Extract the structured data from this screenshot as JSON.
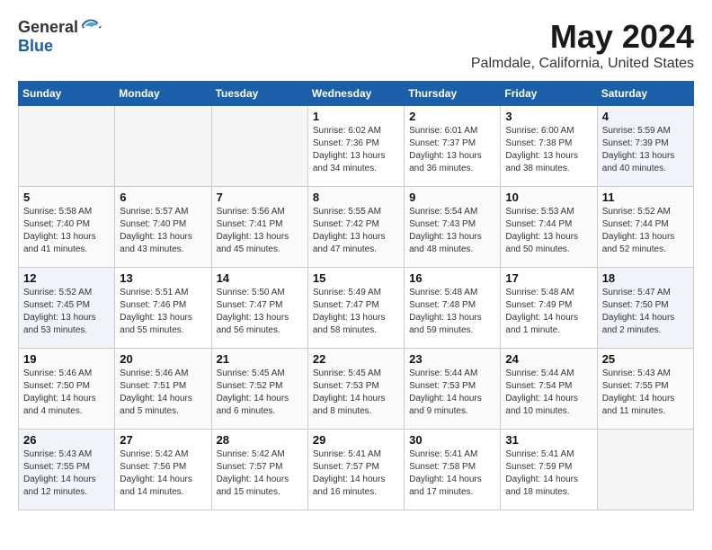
{
  "header": {
    "logo_general": "General",
    "logo_blue": "Blue",
    "month": "May 2024",
    "location": "Palmdale, California, United States"
  },
  "weekdays": [
    "Sunday",
    "Monday",
    "Tuesday",
    "Wednesday",
    "Thursday",
    "Friday",
    "Saturday"
  ],
  "weeks": [
    [
      {
        "day": "",
        "info": ""
      },
      {
        "day": "",
        "info": ""
      },
      {
        "day": "",
        "info": ""
      },
      {
        "day": "1",
        "info": "Sunrise: 6:02 AM\nSunset: 7:36 PM\nDaylight: 13 hours\nand 34 minutes."
      },
      {
        "day": "2",
        "info": "Sunrise: 6:01 AM\nSunset: 7:37 PM\nDaylight: 13 hours\nand 36 minutes."
      },
      {
        "day": "3",
        "info": "Sunrise: 6:00 AM\nSunset: 7:38 PM\nDaylight: 13 hours\nand 38 minutes."
      },
      {
        "day": "4",
        "info": "Sunrise: 5:59 AM\nSunset: 7:39 PM\nDaylight: 13 hours\nand 40 minutes."
      }
    ],
    [
      {
        "day": "5",
        "info": "Sunrise: 5:58 AM\nSunset: 7:40 PM\nDaylight: 13 hours\nand 41 minutes."
      },
      {
        "day": "6",
        "info": "Sunrise: 5:57 AM\nSunset: 7:40 PM\nDaylight: 13 hours\nand 43 minutes."
      },
      {
        "day": "7",
        "info": "Sunrise: 5:56 AM\nSunset: 7:41 PM\nDaylight: 13 hours\nand 45 minutes."
      },
      {
        "day": "8",
        "info": "Sunrise: 5:55 AM\nSunset: 7:42 PM\nDaylight: 13 hours\nand 47 minutes."
      },
      {
        "day": "9",
        "info": "Sunrise: 5:54 AM\nSunset: 7:43 PM\nDaylight: 13 hours\nand 48 minutes."
      },
      {
        "day": "10",
        "info": "Sunrise: 5:53 AM\nSunset: 7:44 PM\nDaylight: 13 hours\nand 50 minutes."
      },
      {
        "day": "11",
        "info": "Sunrise: 5:52 AM\nSunset: 7:44 PM\nDaylight: 13 hours\nand 52 minutes."
      }
    ],
    [
      {
        "day": "12",
        "info": "Sunrise: 5:52 AM\nSunset: 7:45 PM\nDaylight: 13 hours\nand 53 minutes."
      },
      {
        "day": "13",
        "info": "Sunrise: 5:51 AM\nSunset: 7:46 PM\nDaylight: 13 hours\nand 55 minutes."
      },
      {
        "day": "14",
        "info": "Sunrise: 5:50 AM\nSunset: 7:47 PM\nDaylight: 13 hours\nand 56 minutes."
      },
      {
        "day": "15",
        "info": "Sunrise: 5:49 AM\nSunset: 7:47 PM\nDaylight: 13 hours\nand 58 minutes."
      },
      {
        "day": "16",
        "info": "Sunrise: 5:48 AM\nSunset: 7:48 PM\nDaylight: 13 hours\nand 59 minutes."
      },
      {
        "day": "17",
        "info": "Sunrise: 5:48 AM\nSunset: 7:49 PM\nDaylight: 14 hours\nand 1 minute."
      },
      {
        "day": "18",
        "info": "Sunrise: 5:47 AM\nSunset: 7:50 PM\nDaylight: 14 hours\nand 2 minutes."
      }
    ],
    [
      {
        "day": "19",
        "info": "Sunrise: 5:46 AM\nSunset: 7:50 PM\nDaylight: 14 hours\nand 4 minutes."
      },
      {
        "day": "20",
        "info": "Sunrise: 5:46 AM\nSunset: 7:51 PM\nDaylight: 14 hours\nand 5 minutes."
      },
      {
        "day": "21",
        "info": "Sunrise: 5:45 AM\nSunset: 7:52 PM\nDaylight: 14 hours\nand 6 minutes."
      },
      {
        "day": "22",
        "info": "Sunrise: 5:45 AM\nSunset: 7:53 PM\nDaylight: 14 hours\nand 8 minutes."
      },
      {
        "day": "23",
        "info": "Sunrise: 5:44 AM\nSunset: 7:53 PM\nDaylight: 14 hours\nand 9 minutes."
      },
      {
        "day": "24",
        "info": "Sunrise: 5:44 AM\nSunset: 7:54 PM\nDaylight: 14 hours\nand 10 minutes."
      },
      {
        "day": "25",
        "info": "Sunrise: 5:43 AM\nSunset: 7:55 PM\nDaylight: 14 hours\nand 11 minutes."
      }
    ],
    [
      {
        "day": "26",
        "info": "Sunrise: 5:43 AM\nSunset: 7:55 PM\nDaylight: 14 hours\nand 12 minutes."
      },
      {
        "day": "27",
        "info": "Sunrise: 5:42 AM\nSunset: 7:56 PM\nDaylight: 14 hours\nand 14 minutes."
      },
      {
        "day": "28",
        "info": "Sunrise: 5:42 AM\nSunset: 7:57 PM\nDaylight: 14 hours\nand 15 minutes."
      },
      {
        "day": "29",
        "info": "Sunrise: 5:41 AM\nSunset: 7:57 PM\nDaylight: 14 hours\nand 16 minutes."
      },
      {
        "day": "30",
        "info": "Sunrise: 5:41 AM\nSunset: 7:58 PM\nDaylight: 14 hours\nand 17 minutes."
      },
      {
        "day": "31",
        "info": "Sunrise: 5:41 AM\nSunset: 7:59 PM\nDaylight: 14 hours\nand 18 minutes."
      },
      {
        "day": "",
        "info": ""
      }
    ]
  ]
}
